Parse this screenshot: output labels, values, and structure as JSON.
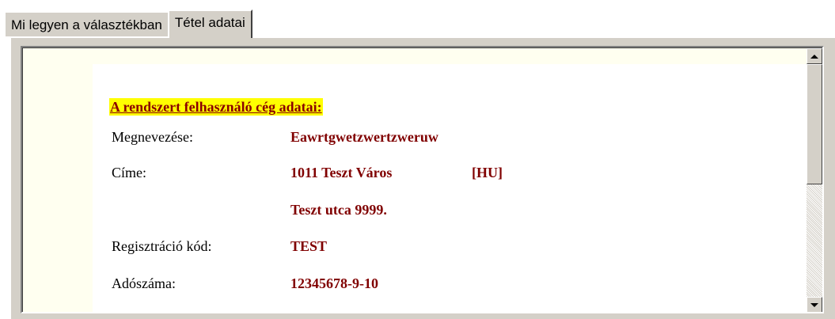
{
  "tabs": [
    {
      "label": "Mi legyen a választékban",
      "active": false
    },
    {
      "label": "Tétel adatai",
      "active": true
    }
  ],
  "company": {
    "heading": "A rendszert felhasználó cég adatai:",
    "fields": [
      {
        "label": "Megnevezése:",
        "value": "Eawrtgwetzwertzweruw"
      },
      {
        "label": "Címe:",
        "value": "1011 Teszt Város",
        "extra": "[HU]"
      },
      {
        "label": "",
        "value": "Teszt utca 9999."
      },
      {
        "label": "Regisztráció kód:",
        "value": "TEST"
      },
      {
        "label": "Adószáma:",
        "value": "12345678-9-10"
      }
    ]
  },
  "colors": {
    "heading_text": "#8b0000",
    "heading_highlight": "#ffff00",
    "value_text": "#800000",
    "page_background": "#fffff0"
  },
  "icons": {
    "scroll_up": "scroll-up-arrow-icon",
    "scroll_down": "scroll-down-arrow-icon"
  }
}
